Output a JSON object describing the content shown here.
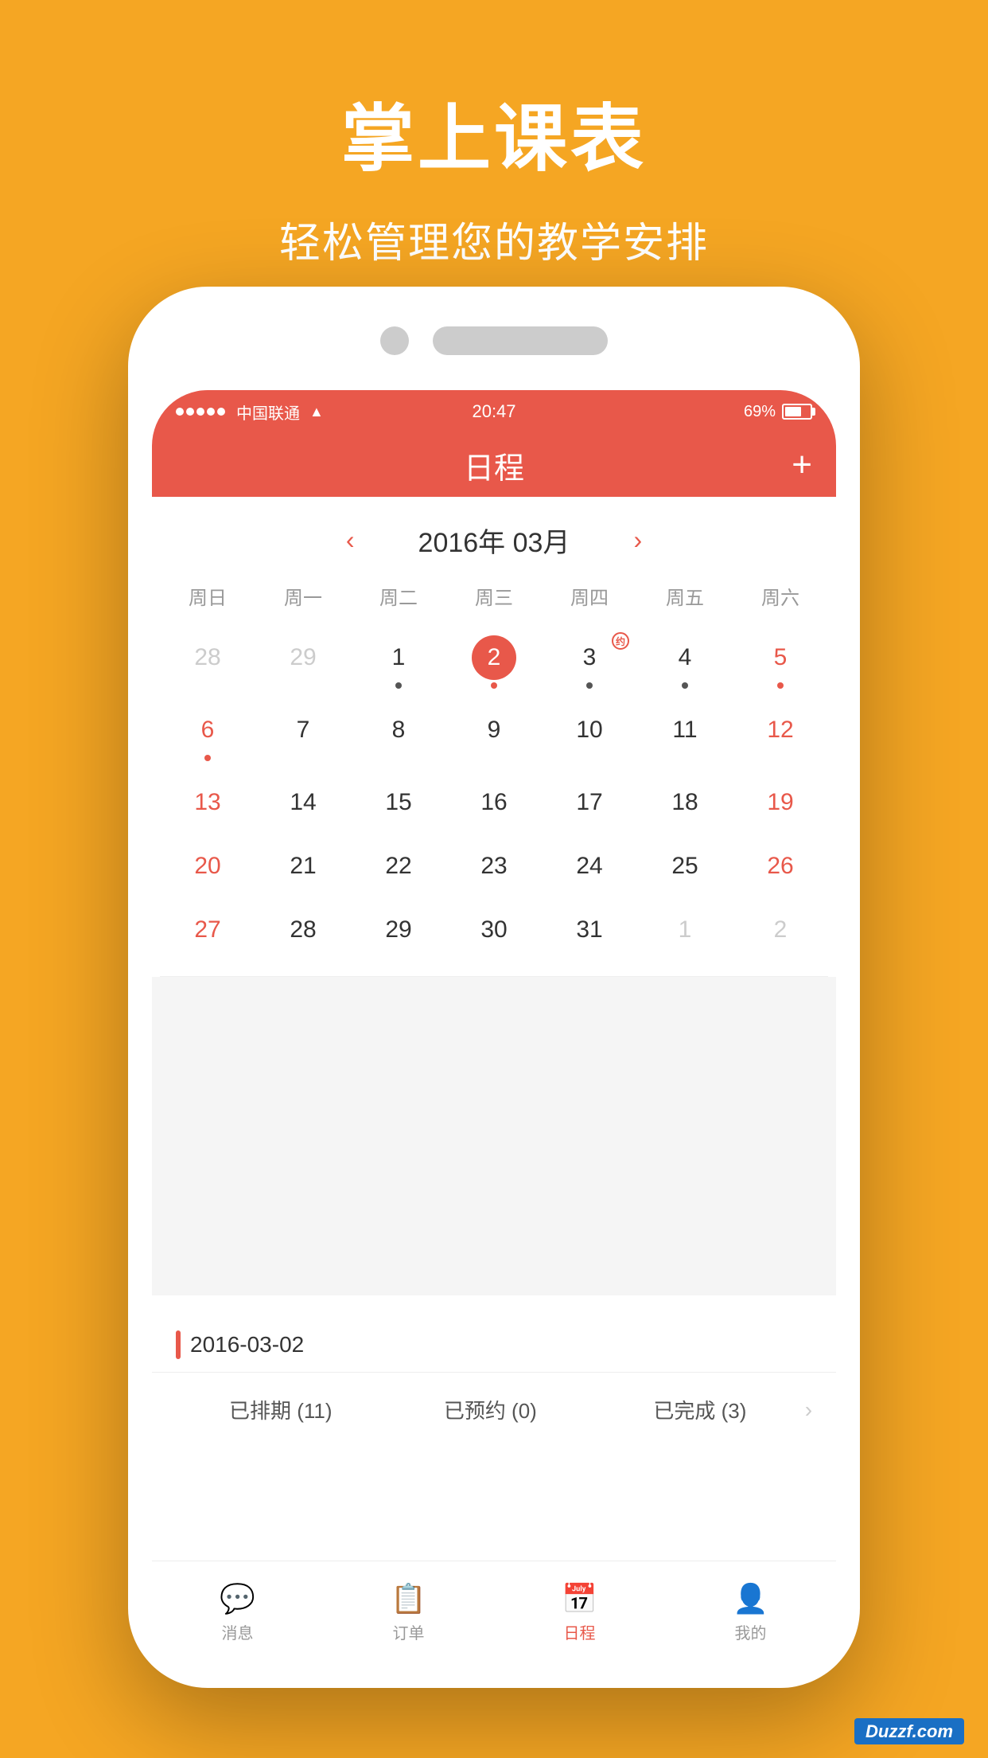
{
  "hero": {
    "title": "掌上课表",
    "subtitle": "轻松管理您的教学安排"
  },
  "status_bar": {
    "carrier": "中国联通",
    "time": "20:47",
    "battery_pct": "69%"
  },
  "header": {
    "title": "日程",
    "add_btn": "+"
  },
  "calendar": {
    "month_title": "2016年 03月",
    "day_headers": [
      "周日",
      "周一",
      "周二",
      "周三",
      "周四",
      "周五",
      "周六"
    ],
    "weeks": [
      [
        {
          "day": "28",
          "type": "gray",
          "dot": false
        },
        {
          "day": "29",
          "type": "gray",
          "dot": false
        },
        {
          "day": "1",
          "type": "normal",
          "dot": true
        },
        {
          "day": "2",
          "type": "today",
          "dot": true
        },
        {
          "day": "3",
          "type": "normal",
          "dot": true,
          "event": "约"
        },
        {
          "day": "4",
          "type": "normal",
          "dot": true
        },
        {
          "day": "5",
          "type": "red",
          "dot": true
        }
      ],
      [
        {
          "day": "6",
          "type": "red",
          "dot": true
        },
        {
          "day": "7",
          "type": "normal",
          "dot": false
        },
        {
          "day": "8",
          "type": "normal",
          "dot": false
        },
        {
          "day": "9",
          "type": "normal",
          "dot": false
        },
        {
          "day": "10",
          "type": "normal",
          "dot": false
        },
        {
          "day": "11",
          "type": "normal",
          "dot": false
        },
        {
          "day": "12",
          "type": "red",
          "dot": false
        }
      ],
      [
        {
          "day": "13",
          "type": "red",
          "dot": false
        },
        {
          "day": "14",
          "type": "normal",
          "dot": false
        },
        {
          "day": "15",
          "type": "normal",
          "dot": false
        },
        {
          "day": "16",
          "type": "normal",
          "dot": false
        },
        {
          "day": "17",
          "type": "normal",
          "dot": false
        },
        {
          "day": "18",
          "type": "normal",
          "dot": false
        },
        {
          "day": "19",
          "type": "red",
          "dot": false
        }
      ],
      [
        {
          "day": "20",
          "type": "red",
          "dot": false
        },
        {
          "day": "21",
          "type": "normal",
          "dot": false
        },
        {
          "day": "22",
          "type": "normal",
          "dot": false
        },
        {
          "day": "23",
          "type": "normal",
          "dot": false
        },
        {
          "day": "24",
          "type": "normal",
          "dot": false
        },
        {
          "day": "25",
          "type": "normal",
          "dot": false
        },
        {
          "day": "26",
          "type": "red",
          "dot": false
        }
      ],
      [
        {
          "day": "27",
          "type": "red",
          "dot": false
        },
        {
          "day": "28",
          "type": "normal",
          "dot": false
        },
        {
          "day": "29",
          "type": "normal",
          "dot": false
        },
        {
          "day": "30",
          "type": "normal",
          "dot": false
        },
        {
          "day": "31",
          "type": "normal",
          "dot": false
        },
        {
          "day": "1",
          "type": "gray",
          "dot": false
        },
        {
          "day": "2",
          "type": "gray",
          "dot": false
        }
      ]
    ]
  },
  "date_section": {
    "label": "2016-03-02"
  },
  "summary": {
    "scheduled": "已排期 (11)",
    "reserved": "已预约 (0)",
    "completed": "已完成 (3)"
  },
  "tabs": [
    {
      "label": "消息",
      "icon": "💬",
      "active": false
    },
    {
      "label": "订单",
      "icon": "📋",
      "active": false
    },
    {
      "label": "日程",
      "icon": "📅",
      "active": true
    },
    {
      "label": "我的",
      "icon": "👤",
      "active": false
    }
  ],
  "watermark": "Duzzf.com"
}
